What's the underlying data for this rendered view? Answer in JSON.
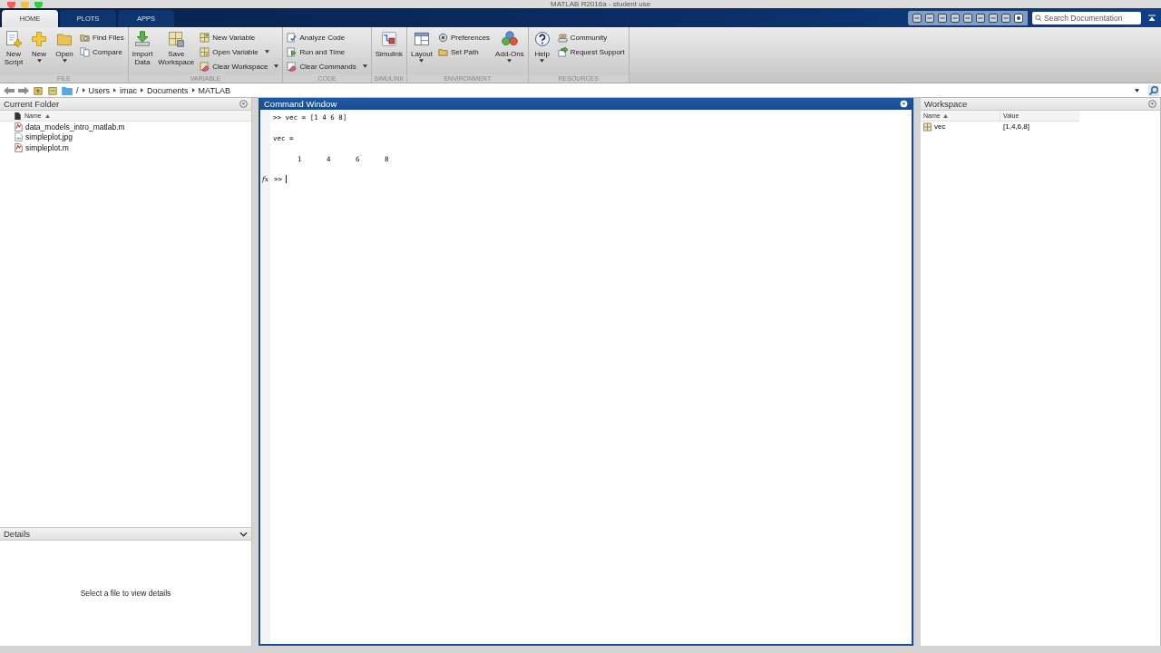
{
  "window": {
    "title": "MATLAB R2016a - student use"
  },
  "tabs": [
    {
      "label": "HOME",
      "selected": true
    },
    {
      "label": "PLOTS",
      "selected": false
    },
    {
      "label": "APPS",
      "selected": false
    }
  ],
  "search": {
    "placeholder": "Search Documentation"
  },
  "ribbon": {
    "sections": [
      {
        "label": "FILE",
        "groups": [
          {
            "kind": "large",
            "lines": [
              "New",
              "Script"
            ],
            "dropdown": false
          },
          {
            "kind": "large",
            "lines": [
              "New"
            ],
            "dropdown": true
          },
          {
            "kind": "large",
            "lines": [
              "Open"
            ],
            "dropdown": true
          },
          {
            "kind": "stack",
            "items": [
              {
                "label": "Find Files",
                "dropdown": false
              },
              {
                "label": "Compare",
                "dropdown": false
              }
            ]
          }
        ]
      },
      {
        "label": "VARIABLE",
        "groups": [
          {
            "kind": "large",
            "lines": [
              "Import",
              "Data"
            ],
            "dropdown": false
          },
          {
            "kind": "large",
            "lines": [
              "Save",
              "Workspace"
            ],
            "dropdown": false
          },
          {
            "kind": "stack",
            "items": [
              {
                "label": "New Variable",
                "dropdown": false
              },
              {
                "label": "Open Variable",
                "dropdown": true
              },
              {
                "label": "Clear Workspace",
                "dropdown": true
              }
            ]
          }
        ]
      },
      {
        "label": "CODE",
        "groups": [
          {
            "kind": "stack",
            "items": [
              {
                "label": "Analyze Code",
                "dropdown": false
              },
              {
                "label": "Run and Time",
                "dropdown": false
              },
              {
                "label": "Clear Commands",
                "dropdown": true
              }
            ]
          }
        ]
      },
      {
        "label": "SIMULINK",
        "groups": [
          {
            "kind": "large",
            "lines": [
              "Simulink"
            ],
            "dropdown": false
          }
        ]
      },
      {
        "label": "ENVIRONMENT",
        "groups": [
          {
            "kind": "large",
            "lines": [
              "Layout"
            ],
            "dropdown": true
          },
          {
            "kind": "stack",
            "items": [
              {
                "label": "Preferences",
                "dropdown": false
              },
              {
                "label": "Set Path",
                "dropdown": false
              }
            ]
          },
          {
            "kind": "large",
            "lines": [
              "Add-Ons"
            ],
            "dropdown": true
          }
        ]
      },
      {
        "label": "RESOURCES",
        "groups": [
          {
            "kind": "large",
            "lines": [
              "Help"
            ],
            "dropdown": true
          },
          {
            "kind": "stack",
            "items": [
              {
                "label": "Community",
                "dropdown": false
              },
              {
                "label": "Request Support",
                "dropdown": false
              }
            ]
          }
        ]
      }
    ]
  },
  "address": {
    "path": [
      "/",
      "Users",
      "imac",
      "Documents",
      "MATLAB"
    ]
  },
  "current_folder": {
    "title": "Current Folder",
    "column": "Name",
    "sorted": true,
    "files": [
      {
        "name": "data_models_intro_matlab.m",
        "kind": "m"
      },
      {
        "name": "simpleplot.jpg",
        "kind": "jpg"
      },
      {
        "name": "simpleplot.m",
        "kind": "m"
      }
    ]
  },
  "details": {
    "title": "Details",
    "expanded": true,
    "message": "Select a file to view details"
  },
  "command_window": {
    "title": "Command Window",
    "lines": [
      {
        "kind": "input",
        "text": ">> vec = [1 4 6 8]"
      },
      {
        "kind": "text",
        "text": "vec ="
      },
      {
        "kind": "values",
        "values": [
          "1",
          "4",
          "6",
          "8"
        ]
      }
    ],
    "fx": "fx",
    "prompt": ">>"
  },
  "workspace": {
    "title": "Workspace",
    "columns": [
      {
        "label": "Name",
        "sorted": true
      },
      {
        "label": "Value",
        "sorted": false
      }
    ],
    "variables": [
      {
        "name": "vec",
        "value": "[1,4,6,8]"
      }
    ]
  }
}
